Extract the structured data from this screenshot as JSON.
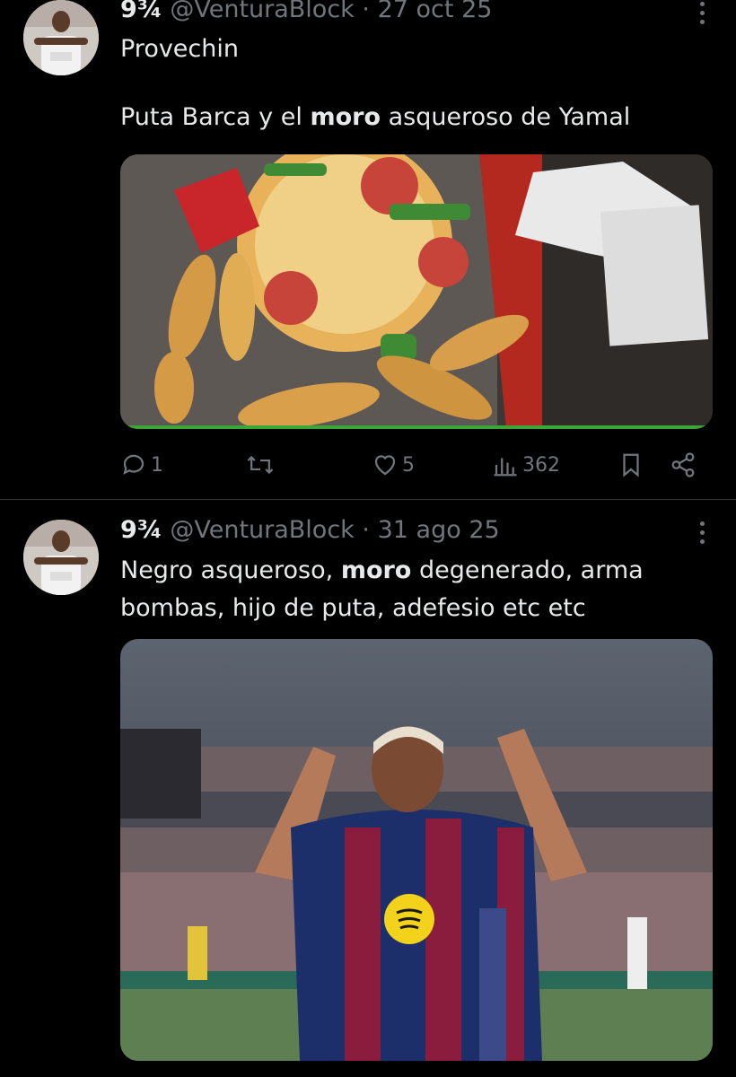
{
  "tweets": [
    {
      "display_name": "9¾",
      "handle": "@VenturaBlock",
      "separator": "·",
      "date": "27 oct 25",
      "line1": "Provechin",
      "line2_pre": "Puta Barca y el ",
      "line2_bold": "moro",
      "line2_post": " asqueroso de Yamal",
      "media": "pizza-and-fries-photo",
      "actions": {
        "replies": "1",
        "reposts": "",
        "likes": "5",
        "views": "362"
      }
    },
    {
      "display_name": "9¾",
      "handle": "@VenturaBlock",
      "separator": "·",
      "date": "31 ago 25",
      "line1_pre": "Negro asqueroso, ",
      "line1_bold": "moro",
      "line1_post": " degenerado, arma",
      "line2": "bombas, hijo de puta, adefesio etc etc",
      "media": "football-player-celebration-photo"
    }
  ],
  "icons": {
    "reply": "speech-bubble-icon",
    "repost": "repost-arrows-icon",
    "like": "heart-icon",
    "views": "bar-chart-icon",
    "bookmark": "bookmark-icon",
    "share": "share-icon",
    "more": "vertical-dots-icon"
  },
  "colors": {
    "background": "#000000",
    "text": "#e7e9ea",
    "secondary": "#71767b",
    "divider": "#2f3336"
  }
}
